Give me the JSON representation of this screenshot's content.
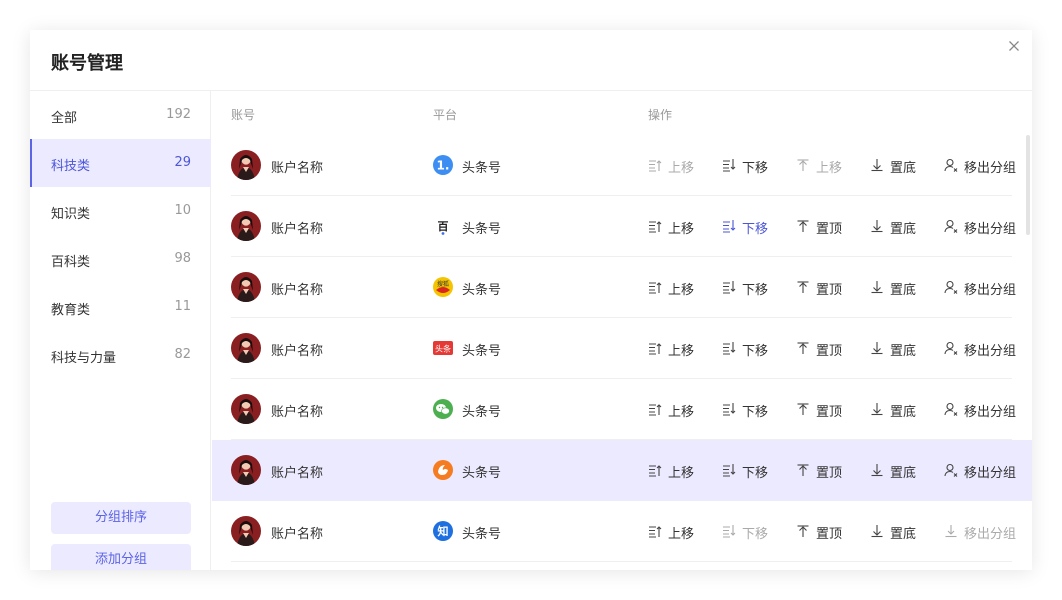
{
  "modal": {
    "title": "账号管理",
    "close_label": "×"
  },
  "sidebar": {
    "items": [
      {
        "label": "全部",
        "count": "192",
        "active": false
      },
      {
        "label": "科技类",
        "count": "29",
        "active": true
      },
      {
        "label": "知识类",
        "count": "10",
        "active": false
      },
      {
        "label": "百科类",
        "count": "98",
        "active": false
      },
      {
        "label": "教育类",
        "count": "11",
        "active": false
      },
      {
        "label": "科技与力量",
        "count": "82",
        "active": false
      }
    ],
    "sort_button": "分组排序",
    "add_button": "添加分组"
  },
  "table": {
    "headers": {
      "account": "账号",
      "platform": "平台",
      "actions": "操作"
    },
    "action_labels": {
      "move_up": "上移",
      "move_down": "下移",
      "top": "置顶",
      "bottom": "置底",
      "remove": "移出分组"
    },
    "rows": [
      {
        "name": "账户名称",
        "platform": "头条号",
        "platform_icon": "one-icon",
        "disabled": [
          "move_up",
          "top"
        ],
        "accent": [],
        "highlight": false
      },
      {
        "name": "账户名称",
        "platform": "头条号",
        "platform_icon": "baidu-bear-icon",
        "disabled": [],
        "accent": [
          "move_down"
        ],
        "highlight": false
      },
      {
        "name": "账户名称",
        "platform": "头条号",
        "platform_icon": "sohu-icon",
        "disabled": [],
        "accent": [],
        "highlight": false
      },
      {
        "name": "账户名称",
        "platform": "头条号",
        "platform_icon": "toutiao-icon",
        "disabled": [],
        "accent": [],
        "highlight": false
      },
      {
        "name": "账户名称",
        "platform": "头条号",
        "platform_icon": "wechat-icon",
        "disabled": [],
        "accent": [],
        "highlight": false
      },
      {
        "name": "账户名称",
        "platform": "头条号",
        "platform_icon": "uc-icon",
        "disabled": [],
        "accent": [],
        "highlight": true
      },
      {
        "name": "账户名称",
        "platform": "头条号",
        "platform_icon": "zhihu-icon",
        "disabled": [
          "move_down",
          "remove"
        ],
        "accent": [],
        "highlight": false
      }
    ]
  },
  "colors": {
    "accent": "#5b63e6",
    "highlight_bg": "#eceaff",
    "disabled": "#aaaaaa"
  }
}
